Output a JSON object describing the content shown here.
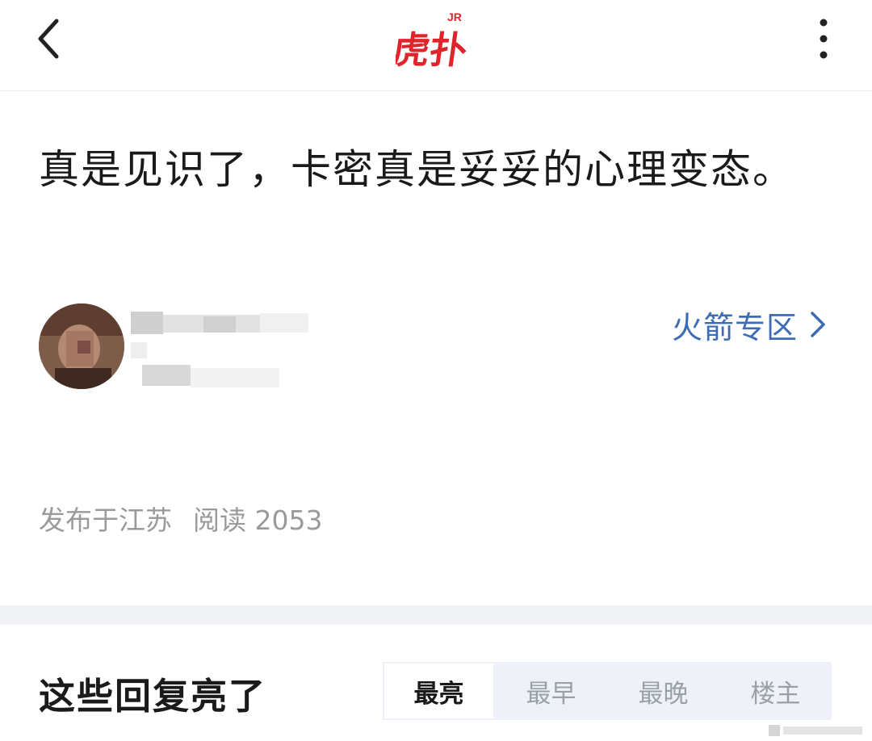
{
  "header": {
    "back_icon": "chevron-left-icon",
    "logo_text": "虎扑",
    "logo_badge": "JR",
    "logo_color": "#e0242b",
    "more_icon": "vertical-dots-icon"
  },
  "post": {
    "title": "真是见识了，卡密真是妥妥的心理变态。",
    "zone_label": "火箭专区",
    "zone_color": "#3d6cb6",
    "location": "发布于江苏",
    "reads": "阅读 2053"
  },
  "replies": {
    "heading": "这些回复亮了",
    "tabs": [
      {
        "label": "最亮",
        "active": true
      },
      {
        "label": "最早",
        "active": false
      },
      {
        "label": "最晚",
        "active": false
      },
      {
        "label": "楼主",
        "active": false
      }
    ]
  }
}
